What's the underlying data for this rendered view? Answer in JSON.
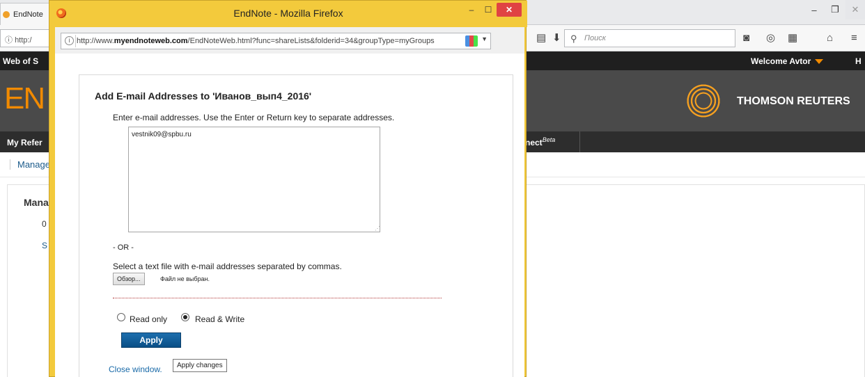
{
  "background_browser": {
    "tab_title": "EndNote",
    "url_fragment": "http:/",
    "search_placeholder": "Поиск",
    "wos_label": "Web of S",
    "welcome_label": "Welcome Avtor",
    "header_cut": "H",
    "brand_letters": "EN",
    "thomson_reuters": "THOMSON REUTERS",
    "menu_my_references": "My Refer",
    "menu_connect": "nect",
    "menu_connect_sup": "Beta",
    "manage_tab": "Manage",
    "page_heading": "Mana",
    "row_value": "0",
    "row_link": "S",
    "accent_color": "#f18a00"
  },
  "popup": {
    "window_title": "EndNote - Mozilla Firefox",
    "url_prefix": "http://www.",
    "url_domain": "myendnoteweb.com",
    "url_path": "/EndNoteWeb.html?func=shareLists&folderid=34&groupType=myGroups",
    "frame_color": "#f3ca3c"
  },
  "dialog": {
    "title": "Add E-mail Addresses to 'Иванов_вып4_2016'",
    "instructions": "Enter e-mail addresses. Use the Enter or Return key to separate addresses.",
    "email_value": "vestnik09@spbu.ru",
    "or_text": "- OR -",
    "file_instructions": "Select a text file with e-mail addresses separated by commas.",
    "browse_label": "Обзор...",
    "file_status": "Файл не выбран.",
    "permission_options": [
      {
        "label": "Read only",
        "selected": false
      },
      {
        "label": "Read & Write",
        "selected": true
      }
    ],
    "apply_label": "Apply",
    "close_label": "Close window.",
    "tooltip": "Apply changes"
  }
}
